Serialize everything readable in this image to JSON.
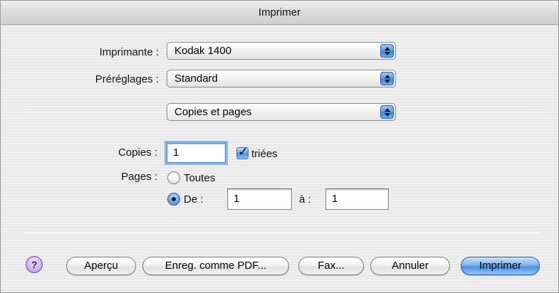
{
  "window": {
    "title": "Imprimer"
  },
  "printer": {
    "label": "Imprimante :",
    "value": "Kodak 1400"
  },
  "presets": {
    "label": "Préréglages :",
    "value": "Standard"
  },
  "panel": {
    "value": "Copies et pages"
  },
  "copies": {
    "label": "Copies :",
    "value": "1",
    "collated_label": "triées",
    "collated_checked": true
  },
  "pages": {
    "label": "Pages :",
    "all_label": "Toutes",
    "from_label": "De :",
    "from_value": "1",
    "to_label": "à :",
    "to_value": "1",
    "selected": "from"
  },
  "buttons": {
    "help": "?",
    "preview": "Aperçu",
    "save_pdf": "Enreg. comme PDF...",
    "fax": "Fax...",
    "cancel": "Annuler",
    "print": "Imprimer"
  },
  "colors": {
    "accent": "#4b8fe0",
    "window_bg": "#ececec"
  }
}
